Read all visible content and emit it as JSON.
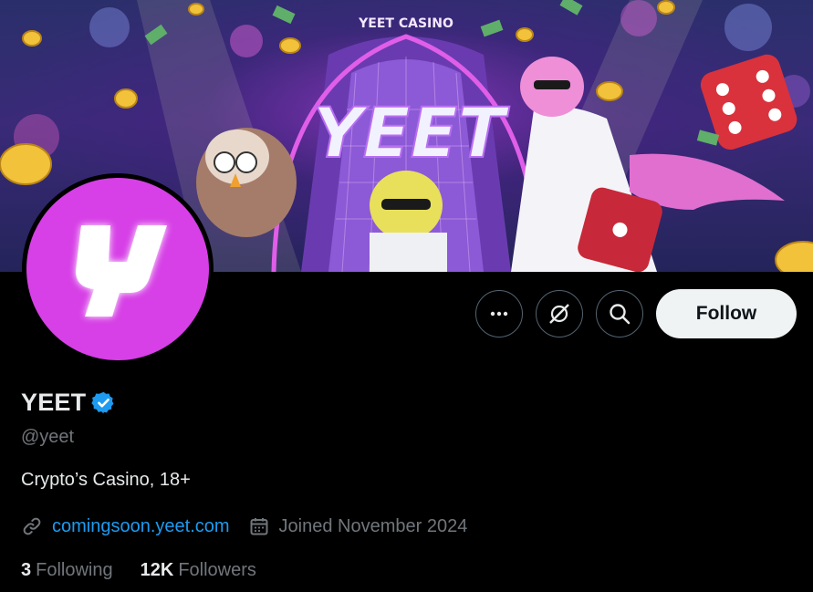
{
  "banner": {
    "sign_text": "YEET",
    "building_sign": "YEET CASINO"
  },
  "avatar": {
    "glyph": "Y"
  },
  "actions": {
    "more_icon": "more-dots-icon",
    "grok_icon": "grok-icon",
    "search_icon": "search-icon",
    "follow_label": "Follow"
  },
  "profile": {
    "display_name": "YEET",
    "handle": "@yeet",
    "bio": "Crypto’s Casino, 18+",
    "website": "comingsoon.yeet.com",
    "joined": "Joined November 2024",
    "following_count": "3",
    "following_label": "Following",
    "followers_count": "12K",
    "followers_label": "Followers"
  },
  "colors": {
    "accent": "#1d9bf0",
    "avatar_bg": "#d640e6",
    "secondary_text": "#71767b"
  }
}
